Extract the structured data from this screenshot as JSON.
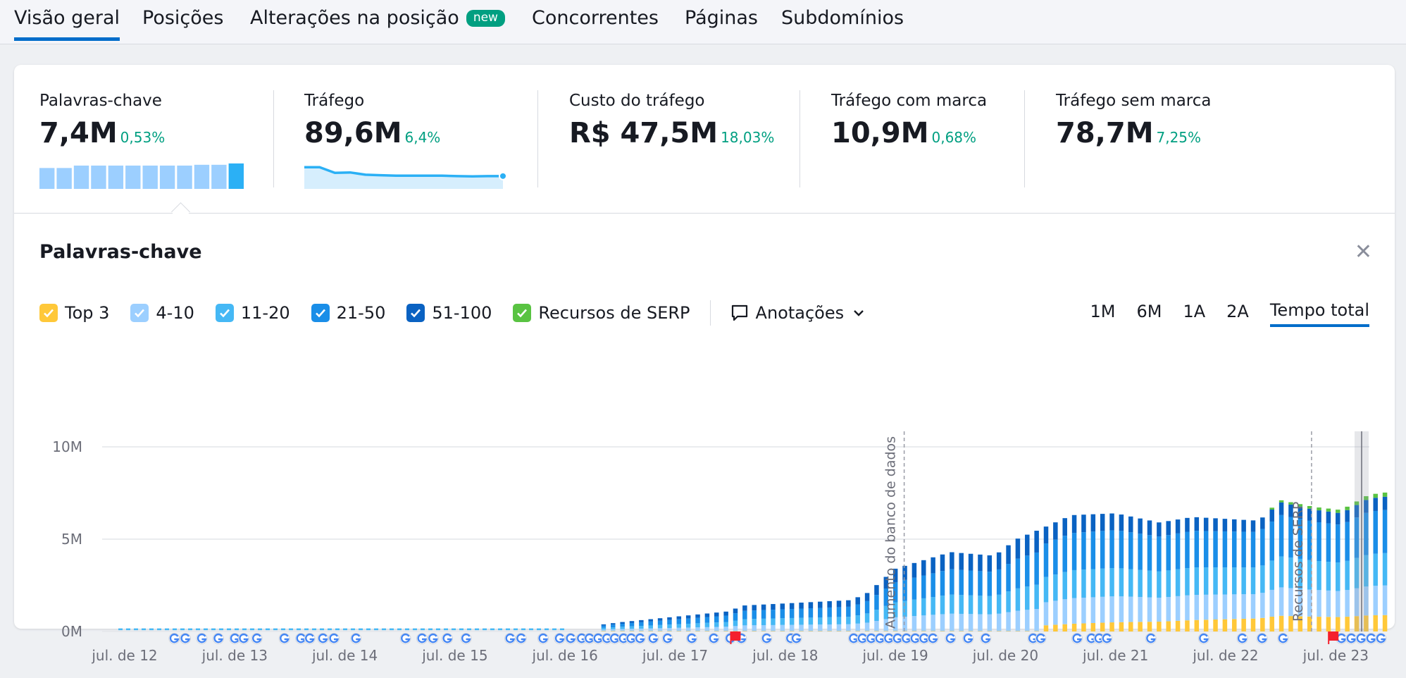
{
  "tabs": [
    {
      "label": "Visão geral",
      "active": true
    },
    {
      "label": "Posições",
      "active": false
    },
    {
      "label": "Alterações na posição",
      "active": false,
      "badge": "new"
    },
    {
      "label": "Concorrentes",
      "active": false
    },
    {
      "label": "Páginas",
      "active": false
    },
    {
      "label": "Subdomínios",
      "active": false
    }
  ],
  "metrics": [
    {
      "label": "Palavras-chave",
      "value": "7,4M",
      "change": "0,53%"
    },
    {
      "label": "Tráfego",
      "value": "89,6M",
      "change": "6,4%"
    },
    {
      "label": "Custo do tráfego",
      "value": "R$ 47,5M",
      "change": "18,03%"
    },
    {
      "label": "Tráfego com marca",
      "value": "10,9M",
      "change": "0,68%"
    },
    {
      "label": "Tráfego sem marca",
      "value": "78,7M",
      "change": "7,25%"
    }
  ],
  "keyword_spark": [
    0.78,
    0.78,
    0.87,
    0.87,
    0.87,
    0.87,
    0.87,
    0.87,
    0.87,
    0.9,
    0.9,
    0.95
  ],
  "traffic_spark": [
    0.95,
    0.95,
    0.7,
    0.72,
    0.62,
    0.6,
    0.58,
    0.58,
    0.58,
    0.58,
    0.56,
    0.55,
    0.56,
    0.56
  ],
  "panel": {
    "title": "Palavras-chave",
    "close_icon": "close-icon"
  },
  "legend": [
    {
      "label": "Top 3",
      "color": "#ffc839",
      "checked": true
    },
    {
      "label": "4-10",
      "color": "#9ccfff",
      "checked": true
    },
    {
      "label": "11-20",
      "color": "#45b8f5",
      "checked": true
    },
    {
      "label": "21-50",
      "color": "#1a8ee8",
      "checked": true
    },
    {
      "label": "51-100",
      "color": "#0a62c2",
      "checked": true
    },
    {
      "label": "Recursos de SERP",
      "color": "#59c342",
      "checked": true
    }
  ],
  "annotations_label": "Anotações",
  "periods": [
    {
      "label": "1M",
      "active": false
    },
    {
      "label": "6M",
      "active": false
    },
    {
      "label": "1A",
      "active": false
    },
    {
      "label": "2A",
      "active": false
    },
    {
      "label": "Tempo total",
      "active": true
    }
  ],
  "chart_data": {
    "type": "bar",
    "stacked": true,
    "x_tick_labels": [
      "jul. de 12",
      "jul. de 13",
      "jul. de 14",
      "jul. de 15",
      "jul. de 16",
      "jul. de 17",
      "jul. de 18",
      "jul. de 19",
      "jul. de 20",
      "jul. de 21",
      "jul. de 22",
      "jul. de 23"
    ],
    "y_tick_labels": [
      "10M",
      "5M",
      "0M"
    ],
    "ylim": [
      0,
      10000000
    ],
    "grid": true,
    "series_names": [
      "Top 3",
      "4-10",
      "11-20",
      "21-50",
      "51-100",
      "Recursos de SERP"
    ],
    "annotations": [
      {
        "label": "Aumento do banco de dados",
        "at": "jul. de 19"
      },
      {
        "label": "Recursos de SERP",
        "at": "jul. de 23"
      }
    ],
    "total_profile": [
      [
        2016.0,
        0.12
      ],
      [
        2016.5,
        0.5
      ],
      [
        2017.0,
        0.8
      ],
      [
        2017.5,
        1.1
      ],
      [
        2017.6,
        1.4
      ],
      [
        2018.6,
        1.7
      ],
      [
        2018.75,
        2.1
      ],
      [
        2019.0,
        3.4
      ],
      [
        2019.5,
        4.3
      ],
      [
        2019.9,
        4.1
      ],
      [
        2020.1,
        5.0
      ],
      [
        2020.3,
        5.5
      ],
      [
        2020.6,
        6.3
      ],
      [
        2021.0,
        6.4
      ],
      [
        2021.4,
        5.9
      ],
      [
        2021.7,
        6.2
      ],
      [
        2022.3,
        6.0
      ],
      [
        2022.5,
        7.0
      ],
      [
        2022.8,
        6.6
      ],
      [
        2023.05,
        6.4
      ],
      [
        2023.3,
        7.2
      ],
      [
        2023.45,
        7.3
      ]
    ]
  }
}
